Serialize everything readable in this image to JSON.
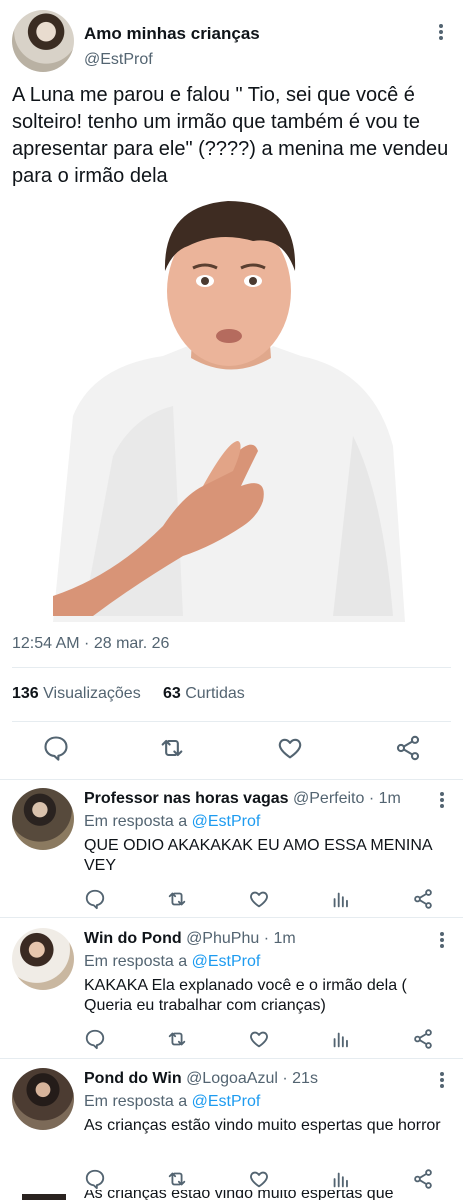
{
  "tweet": {
    "display_name": "Amo minhas crianças",
    "handle": "@EstProf",
    "text": "A Luna me parou e falou \" Tio, sei que você é solteiro! tenho um irmão que também é vou te apresentar para ele\" (????) a menina me vendeu para o irmão dela",
    "timestamp": "12:54 AM · 28 mar. 26",
    "views_count": "136",
    "views_label": "Visualizações",
    "likes_count": "63",
    "likes_label": "Curtidas",
    "actions": [
      "reply-icon",
      "retweet-icon",
      "like-icon",
      "share-icon"
    ]
  },
  "replies": [
    {
      "name": "Professor nas horas vagas",
      "meta": "@Perfeito · 1m",
      "in_reply_prefix": "Em resposta a",
      "in_reply_handle": "@EstProf",
      "text": "QUE ODIO AKAKAKAK EU AMO ESSA MENINA VEY"
    },
    {
      "name": "Win do Pond",
      "meta": "@PhuPhu · 1m",
      "in_reply_prefix": "Em resposta a",
      "in_reply_handle": "@EstProf",
      "text": "KAKAKA Ela explanado você e o irmão dela ( Queria eu trabalhar com crianças)"
    },
    {
      "name": "Pond do Win",
      "meta": "@LogoaAzul · 21s",
      "in_reply_prefix": "Em resposta a",
      "in_reply_handle": "@EstProf",
      "text": "As crianças estão vindo muito espertas que horror"
    },
    {
      "text": "As crianças estão vindo muito espertas que"
    }
  ],
  "colors": {
    "accent": "#1d9bf0",
    "muted": "#536471",
    "text": "#0f1419",
    "divider": "#e6ecf0"
  }
}
